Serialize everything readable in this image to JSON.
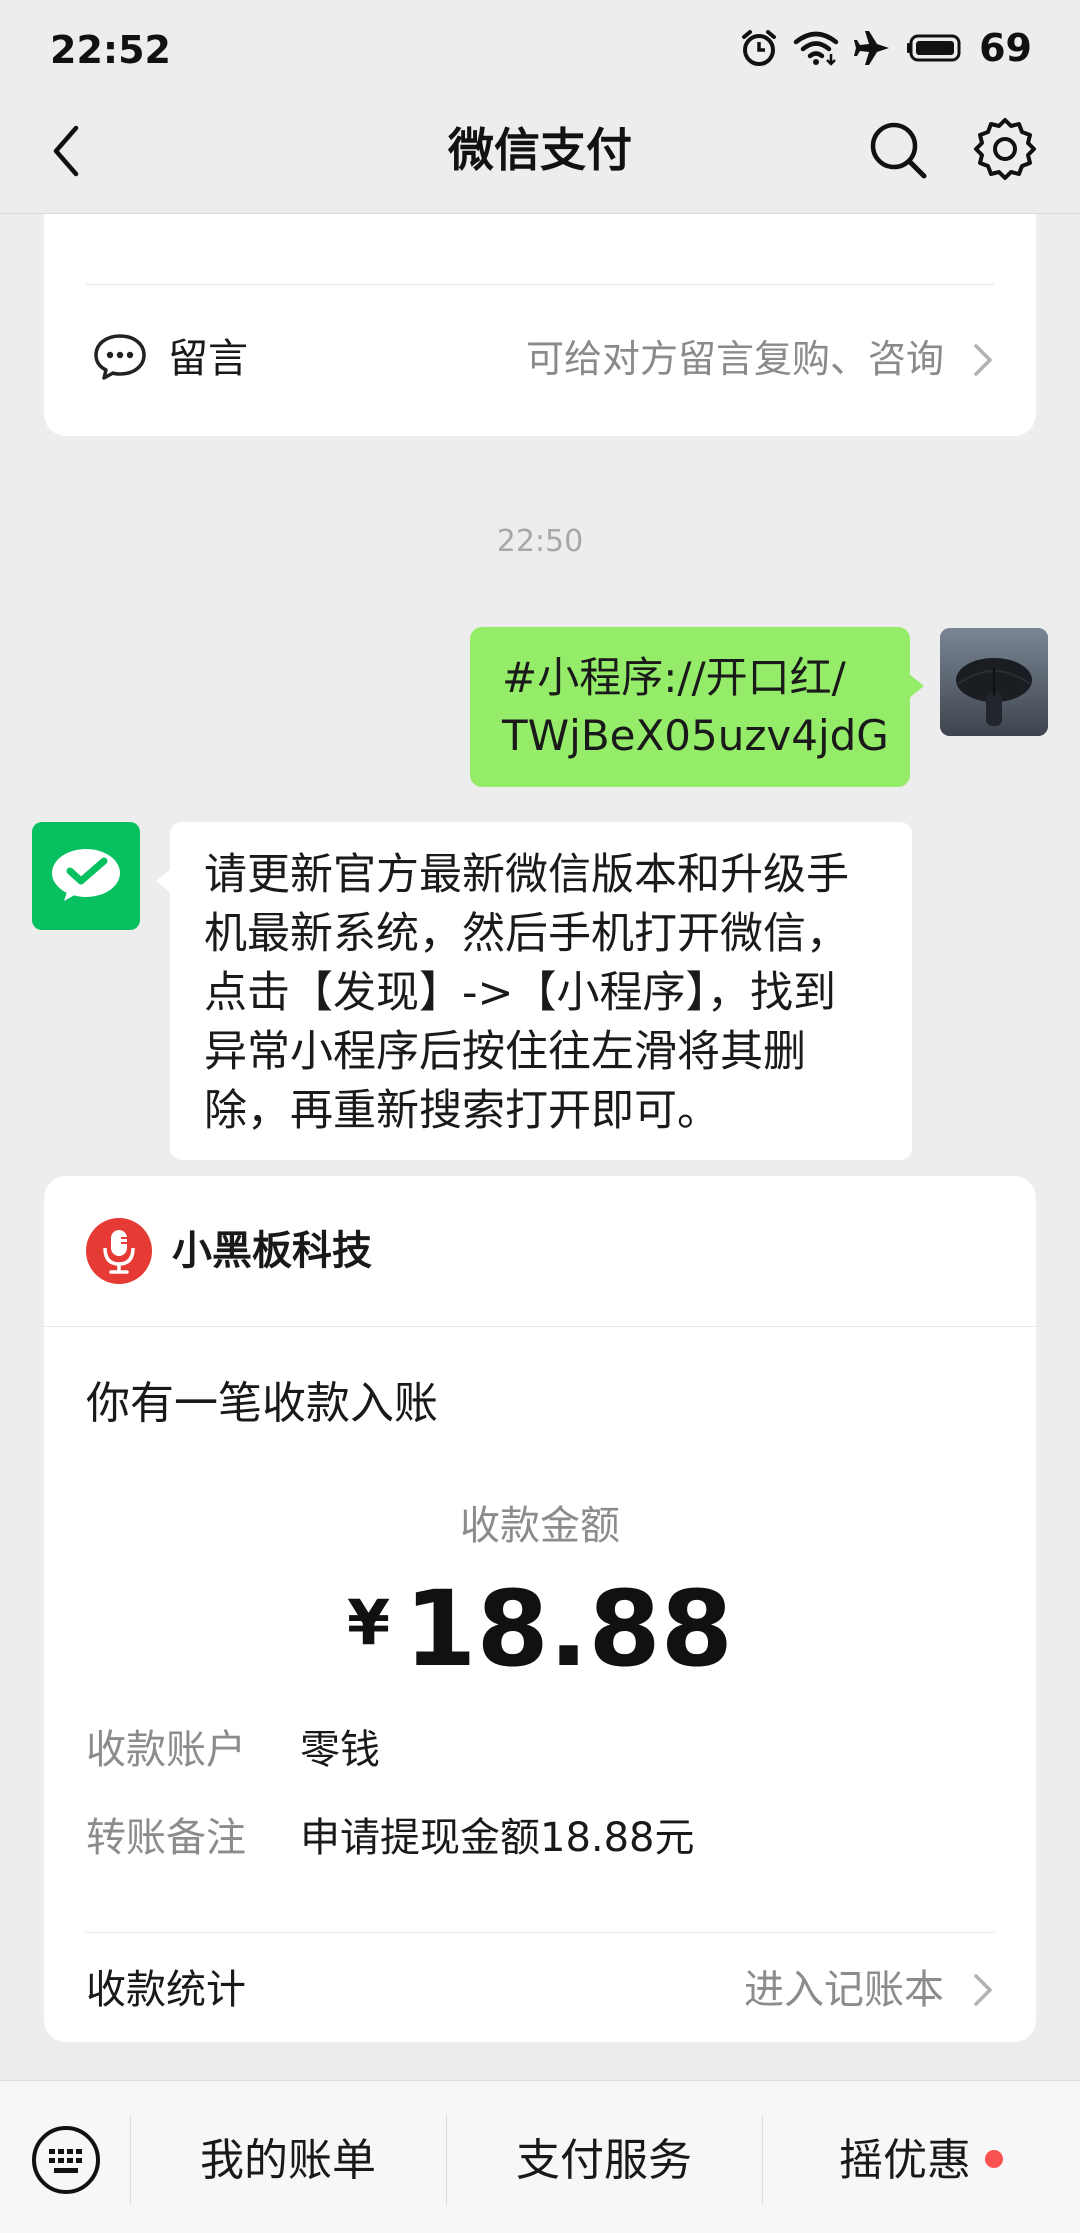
{
  "status_bar": {
    "time": "22:52",
    "battery_level": "69",
    "icons": [
      "alarm-icon",
      "wifi-icon",
      "airplane-icon",
      "battery-icon"
    ]
  },
  "nav": {
    "title": "微信支付",
    "icons": [
      "back-icon",
      "search-icon",
      "settings-icon"
    ]
  },
  "message_card": {
    "label": "留言",
    "hint": "可给对方留言复购、咨询",
    "icon": "chat-bubble-icon"
  },
  "chat": {
    "timestamp": "22:50",
    "sent": {
      "line1": "#小程序://开口红/",
      "line2": "TWjBeX05uzv4jdG"
    },
    "received": {
      "lines": [
        "请更新官方最新微信版本和升级手",
        "机最新系统，然后手机打开微信，",
        "点击【发现】->【小程序】，找到",
        "异常小程序后按住往左滑将其删",
        "除，再重新搜索打开即可。"
      ]
    }
  },
  "payment": {
    "merchant": "小黑板科技",
    "title": "你有一笔收款入账",
    "amount_label": "收款金额",
    "currency_symbol": "¥",
    "amount": "18.88",
    "account_label": "收款账户",
    "account_value": "零钱",
    "note_label": "转账备注",
    "note_value": "申请提现金额18.88元",
    "stats_label": "收款统计",
    "stats_link": "进入记账本"
  },
  "bottom_bar": {
    "items": [
      "我的账单",
      "支付服务",
      "摇优惠"
    ]
  },
  "colors": {
    "accent_green": "#07c160",
    "bubble_green": "#95ec69",
    "merchant_red": "#e63a35",
    "badge_red": "#fa5151"
  }
}
